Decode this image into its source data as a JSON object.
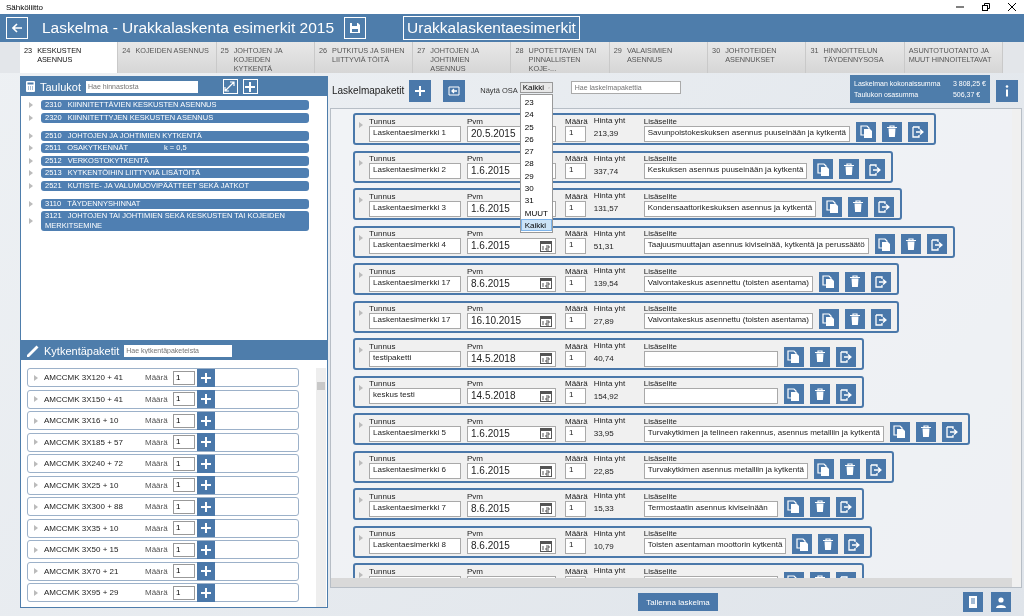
{
  "window": {
    "title": "Sähköliitto"
  },
  "header": {
    "title": "Laskelma - Urakkalaskenta esimerkit 2015",
    "project": "Urakkalaskentaesimerkit"
  },
  "tabs": [
    {
      "number": "23",
      "label": "KESKUSTEN ASENNUS",
      "selected": true
    },
    {
      "number": "24",
      "label": "KOJEIDEN ASENNUS",
      "selected": false
    },
    {
      "number": "25",
      "label": "JOHTOJEN JA KOJEIDEN KYTKENTÄ",
      "selected": false
    },
    {
      "number": "26",
      "label": "PUTKITUS JA SIIHEN LIITTYVIÄ TÖITÄ",
      "selected": false
    },
    {
      "number": "27",
      "label": "JOHTOJEN JA JOHTIMIEN ASENNUS",
      "selected": false
    },
    {
      "number": "28",
      "label": "UPOTETTAVIEN TAI PINNALLISTEN KOJE-...",
      "selected": false
    },
    {
      "number": "29",
      "label": "VALAISIMIEN ASENNUS",
      "selected": false
    },
    {
      "number": "30",
      "label": "JOHTOTEIDEN ASENNUKSET",
      "selected": false
    },
    {
      "number": "31",
      "label": "HINNOITTELUN TÄYDENNYSOSA",
      "selected": false
    },
    {
      "label": "ASUNTOTUOTANTO JA MUUT HINNOITELTAVAT",
      "selected": false
    }
  ],
  "price_tables": {
    "title": "Taulukot",
    "search": {
      "placeholder": "Hae hinnastosta"
    },
    "groups": [
      {
        "items": [
          {
            "code": "2310",
            "label": "KIINNITETTÄVIEN KESKUSTEN ASENNUS"
          },
          {
            "code": "2320",
            "label": "KIINNITETTYJEN KESKUSTEN ASENNUS"
          }
        ]
      },
      {
        "items": [
          {
            "code": "2510",
            "label": "JOHTOJEN JA JOHTIMIEN KYTKENTÄ"
          },
          {
            "code": "2511",
            "label": "OSAKYTKENNÄT",
            "note": "k = 0,5"
          },
          {
            "code": "2512",
            "label": "VERKOSTOKYTKENTÄ"
          },
          {
            "code": "2513",
            "label": "KYTKENTÖIHIN LIITTYVIÄ LISÄTÖITÄ"
          },
          {
            "code": "2521",
            "label": "KUTISTE- JA VALUMUOVIPÄÄTTEET SEKÄ JATKOT"
          }
        ]
      },
      {
        "items": [
          {
            "code": "3110",
            "label": "TÄYDENNYSHINNAT"
          },
          {
            "code": "3121",
            "label": "JOHTOJEN TAI JOHTIMIEN SEKÄ KESKUSTEN TAI KOJEIDEN MERKITSEMINE"
          }
        ]
      }
    ]
  },
  "packages": {
    "title": "Kytkentäpaketit",
    "search": {
      "placeholder": "Hae kytkentäpaketeista"
    },
    "items": [
      {
        "name": "AMCCMK 3X120 + 41",
        "quantity_label": "Määrä",
        "quantity": "1"
      },
      {
        "name": "AMCCMK 3X150 + 41",
        "quantity_label": "Määrä",
        "quantity": "1"
      },
      {
        "name": "AMCCMK 3X16 + 10",
        "quantity_label": "Määrä",
        "quantity": "1"
      },
      {
        "name": "AMCCMK 3X185 + 57",
        "quantity_label": "Määrä",
        "quantity": "1"
      },
      {
        "name": "AMCCMK 3X240 + 72",
        "quantity_label": "Määrä",
        "quantity": "1"
      },
      {
        "name": "AMCCMK 3X25 + 10",
        "quantity_label": "Määrä",
        "quantity": "1"
      },
      {
        "name": "AMCCMK 3X300 + 88",
        "quantity_label": "Määrä",
        "quantity": "1"
      },
      {
        "name": "AMCCMK 3X35 + 10",
        "quantity_label": "Määrä",
        "quantity": "1"
      },
      {
        "name": "AMCCMK 3X50 + 15",
        "quantity_label": "Määrä",
        "quantity": "1"
      },
      {
        "name": "AMCCMK 3X70 + 21",
        "quantity_label": "Määrä",
        "quantity": "1"
      },
      {
        "name": "AMCCMK 3X95 + 29",
        "quantity_label": "Määrä",
        "quantity": "1"
      }
    ]
  },
  "calculation": {
    "title": "Laskelmapaketit",
    "filter": {
      "label": "Näytä OSA",
      "value": "Kaikki",
      "options": [
        {
          "label": "23",
          "selected": false
        },
        {
          "label": "24",
          "selected": false
        },
        {
          "label": "25",
          "selected": false
        },
        {
          "label": "26",
          "selected": false
        },
        {
          "label": "27",
          "selected": false
        },
        {
          "label": "28",
          "selected": false
        },
        {
          "label": "29",
          "selected": false
        },
        {
          "label": "30",
          "selected": false
        },
        {
          "label": "31",
          "selected": false
        },
        {
          "label": "MUUT",
          "selected": false
        },
        {
          "label": "Kaikki",
          "selected": true
        }
      ]
    },
    "search": {
      "placeholder": "Hae laskelmapakettia"
    },
    "summary": [
      {
        "label": "Laskelman kokonaissumma",
        "value": "3 808,25 €"
      },
      {
        "label": "Taulukon osasumma",
        "value": "506,37 €"
      }
    ],
    "rows": [
      {
        "id_label": "Tunnus",
        "id": "Laskentaesimerkki 1",
        "date_label": "Pvm",
        "date": "20.5.2015",
        "qty_label": "Määrä",
        "qty": "1",
        "price_label": "Hinta yht",
        "price": "213,39",
        "note_label": "Lisäselite",
        "note": "Savunpoistokeskuksen asennus puuseinään ja kytkentä"
      },
      {
        "id_label": "Tunnus",
        "id": "Laskentaesimerkki 2",
        "date_label": "Pvm",
        "date": "1.6.2015",
        "qty_label": "Määrä",
        "qty": "1",
        "price_label": "Hinta yht",
        "price": "337,74",
        "note_label": "Lisäselite",
        "note": "Keskuksen asennus puuseinään ja kytkentä"
      },
      {
        "id_label": "Tunnus",
        "id": "Laskentaesimerkki 3",
        "date_label": "Pvm",
        "date": "1.6.2015",
        "qty_label": "Määrä",
        "qty": "1",
        "price_label": "Hinta yht",
        "price": "131,57",
        "note_label": "Lisäselite",
        "note": "Kondensaattorikeskuksen asennus ja kytkentä"
      },
      {
        "id_label": "Tunnus",
        "id": "Laskentaesimerkki 4",
        "date_label": "Pvm",
        "date": "1.6.2015",
        "qty_label": "Määrä",
        "qty": "1",
        "price_label": "Hinta yht",
        "price": "51,31",
        "note_label": "Lisäselite",
        "note": "Taajuusmuuttajan asennus kiviseinää, kytkentä ja perussäätö"
      },
      {
        "id_label": "Tunnus",
        "id": "Laskentaesimerkki 17",
        "date_label": "Pvm",
        "date": "8.6.2015",
        "qty_label": "Määrä",
        "qty": "1",
        "price_label": "Hinta yht",
        "price": "139,54",
        "note_label": "Lisäselite",
        "note": "Valvontakeskus asennettu (toisten asentama)"
      },
      {
        "id_label": "Tunnus",
        "id": "Laskentaesimerkki 17",
        "date_label": "Pvm",
        "date": "16.10.2015",
        "qty_label": "Määrä",
        "qty": "1",
        "price_label": "Hinta yht",
        "price": "27,89",
        "note_label": "Lisäselite",
        "note": "Valvontakeskus asennettu (toisten asentama)"
      },
      {
        "id_label": "Tunnus",
        "id": "testipaketti",
        "date_label": "Pvm",
        "date": "14.5.2018",
        "qty_label": "Määrä",
        "qty": "1",
        "price_label": "Hinta yht",
        "price": "40,74",
        "note_label": "Lisäselite"
      },
      {
        "id_label": "Tunnus",
        "id": "keskus testi",
        "date_label": "Pvm",
        "date": "14.5.2018",
        "qty_label": "Määrä",
        "qty": "1",
        "price_label": "Hinta yht",
        "price": "154,92",
        "note_label": "Lisäselite"
      },
      {
        "id_label": "Tunnus",
        "id": "Laskentaesimerkki 5",
        "date_label": "Pvm",
        "date": "1.6.2015",
        "qty_label": "Määrä",
        "qty": "1",
        "price_label": "Hinta yht",
        "price": "33,95",
        "note_label": "Lisäselite",
        "note": "Turvakytkimen ja telineen rakennus, asennus metalliin ja kytkentä"
      },
      {
        "id_label": "Tunnus",
        "id": "Laskentaesimerkki 6",
        "date_label": "Pvm",
        "date": "1.6.2015",
        "qty_label": "Määrä",
        "qty": "1",
        "price_label": "Hinta yht",
        "price": "22,85",
        "note_label": "Lisäselite",
        "note": "Turvakytkimen asennus metalliin ja kytkentä"
      },
      {
        "id_label": "Tunnus",
        "id": "Laskentaesimerkki 7",
        "date_label": "Pvm",
        "date": "8.6.2015",
        "qty_label": "Määrä",
        "qty": "1",
        "price_label": "Hinta yht",
        "price": "15,33",
        "note_label": "Lisäselite",
        "note": "Termostaatin asennus kiviseinään"
      },
      {
        "id_label": "Tunnus",
        "id": "Laskentaesimerkki 8",
        "date_label": "Pvm",
        "date": "8.6.2015",
        "qty_label": "Määrä",
        "qty": "1",
        "price_label": "Hinta yht",
        "price": "10,79",
        "note_label": "Lisäselite",
        "note": "Toisten asentaman moottorin kytkentä"
      },
      {
        "id_label": "Tunnus",
        "date_label": "Pvm",
        "qty_label": "Määrä",
        "price_label": "Hinta yht",
        "note_label": "Lisäselite"
      }
    ]
  },
  "footer": {
    "save_button": "Tallenna laskelma"
  }
}
